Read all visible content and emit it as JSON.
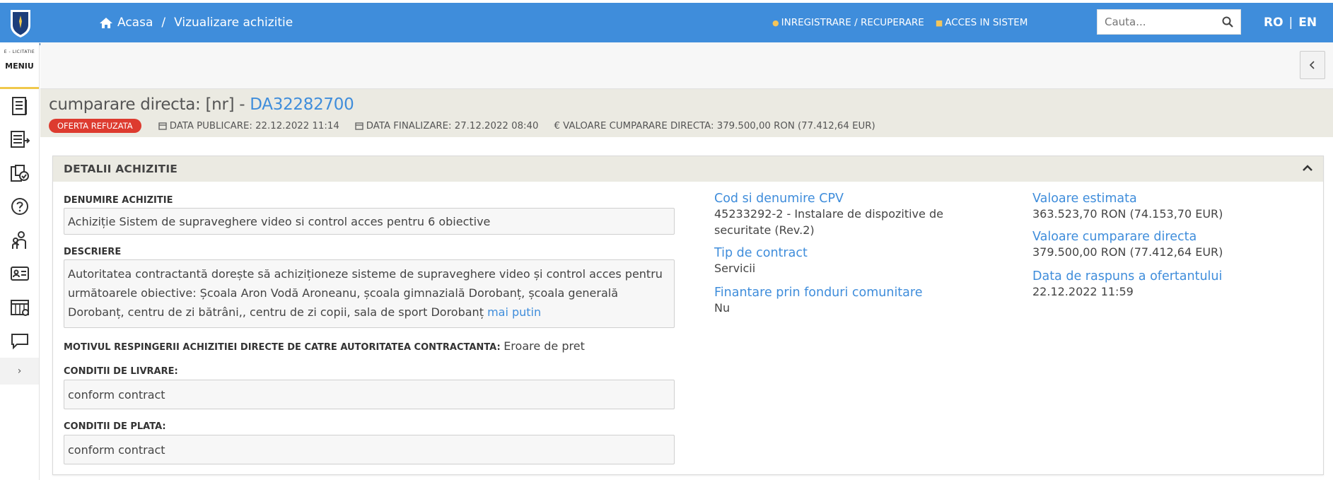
{
  "header": {
    "breadcrumb_home": "Acasa",
    "breadcrumb_sep": "/",
    "breadcrumb_current": "Vizualizare achizitie",
    "nav_register": "INREGISTRARE / RECUPERARE",
    "nav_login": "ACCES IN SISTEM",
    "search_placeholder": "Cauta...",
    "lang_ro": "RO",
    "lang_sep": "|",
    "lang_en": "EN"
  },
  "sidebar": {
    "brand_small": "E - LICITATIE",
    "menu_label": "MENIU",
    "items": [
      "document-icon",
      "list-export-icon",
      "folder-check-icon",
      "help-icon",
      "users-icon",
      "id-card-icon",
      "calendar-icon",
      "chat-icon"
    ],
    "expand_label": "›"
  },
  "title": {
    "prefix": "cumparare directa: [nr] - ",
    "code": "DA32282700",
    "status_badge": "OFERTA REFUZATA",
    "published": "DATA PUBLICARE: 22.12.2022 11:14",
    "finalized": "DATA FINALIZARE: 27.12.2022 08:40",
    "value": "€ VALOARE CUMPARARE DIRECTA: 379.500,00  RON (77.412,64  EUR)"
  },
  "card": {
    "header": "DETALII ACHIZITIE",
    "name_label": "DENUMIRE ACHIZITIE",
    "name_value": "Achiziție Sistem de supraveghere video si control acces pentru 6 obiective",
    "desc_label": "DESCRIERE",
    "desc_value": "Autoritatea contractantă dorește să achiziționeze sisteme de supraveghere video și control acces pentru următoarele obiective: Școala Aron Vodă Aroneanu, școala gimnazială Dorobanț, școala generală Dorobanț, centru de zi bătrâni,, centru de zi copii, sala de sport Dorobanț",
    "desc_more": "mai putin",
    "reason_label": "MOTIVUL RESPINGERII ACHIZITIEI DIRECTE DE CATRE AUTORITATEA CONTRACTANTA:",
    "reason_value": "Eroare de pret",
    "delivery_label": "CONDITII DE LIVRARE:",
    "delivery_value": "conform contract",
    "payment_label": "CONDITII DE PLATA:",
    "payment_value": "conform contract",
    "cpv_title": "Cod si denumire CPV",
    "cpv_value": "45233292-2 - Instalare de dispozitive de securitate (Rev.2)",
    "contract_type_title": "Tip de contract",
    "contract_type_value": "Servicii",
    "eu_funds_title": "Finantare prin fonduri comunitare",
    "eu_funds_value": "Nu",
    "estimated_title": "Valoare estimata",
    "estimated_value": "363.523,70  RON (74.153,70  EUR)",
    "direct_value_title": "Valoare cumparare directa",
    "direct_value_value": "379.500,00  RON (77.412,64  EUR)",
    "response_date_title": "Data de raspuns a ofertantului",
    "response_date_value": "22.12.2022 11:59"
  },
  "colors": {
    "primary": "#3f8ddb",
    "band": "#ebeae2",
    "badge": "#dd3b2f",
    "accent_yellow": "#f0c84b"
  }
}
